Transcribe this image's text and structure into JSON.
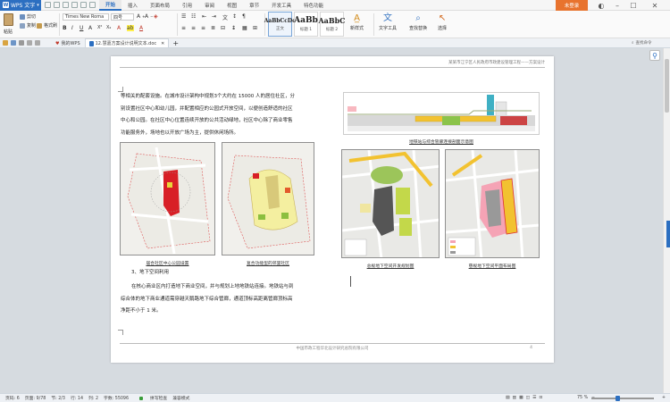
{
  "app": {
    "name": "WPS 文字",
    "login": "未登录"
  },
  "menu": [
    "开始",
    "插入",
    "页面布局",
    "引用",
    "审阅",
    "视图",
    "章节",
    "开发工具",
    "特色功能"
  ],
  "ribbon": {
    "paste": "粘贴",
    "cut": "剪切",
    "copy": "复制",
    "format_painter": "格式刷",
    "font_name": "Times New Roma",
    "font_size": "四号",
    "styles": [
      {
        "preview": "AaBbCcDd",
        "label": "正文"
      },
      {
        "preview": "AaBb",
        "label": "标题 1"
      },
      {
        "preview": "AaBbC",
        "label": "标题 2"
      }
    ],
    "new_style": "新样式",
    "text_tools": "文字工具",
    "find_replace": "查找替换",
    "select": "选择"
  },
  "tabs": {
    "home": "我的WPS",
    "doc": "12.慧嘉方案设计说明文本.doc",
    "search_cmd": "查找命令"
  },
  "document": {
    "header": "某某市江宁区人民政府市政建设管理工程——方案设计",
    "para1_lines": [
      "等相关的配套设施。在城市设计架构中规划3个大约在 15000 人的居住社区，分",
      "别设置社区中心和幼儿园，并配置相应的公园式开放空间，以便创造舒适的社区",
      "中心和公园。在社区中心位置连续开放的公共活动绿地，社区中心除了商业零售",
      "功能服务外，场地也以开放广场为主，提供休闲场所。"
    ],
    "captions": {
      "section": "地铁站与综合管廊连接剖面示意图",
      "map1": "居合社区中心公园设置",
      "map2": "复合功能型的邻里社区",
      "map3": "总规地下空间开发规划图",
      "map4": "慈规地下空间平面布局图"
    },
    "section_heading": "3、地下空间利用",
    "para2_lines": [
      "在核心商业区内打造地下商业空间，并与规划上地地铁站连接。地铁站与到",
      "综合体的地下商业通道需穿越天鹅路地下综合管廊，通道顶标高距离管廊顶标高",
      "净距不小于 1 米。"
    ],
    "footer": "中国市政工程华北设计研究总院有限公司",
    "page_number": "4"
  },
  "status": {
    "page": "页码: 6",
    "pages": "页面: 9/78",
    "section": "节: 2/3",
    "row": "行: 14",
    "col": "列: 2",
    "words": "字数: 55096",
    "spell": "拼写检查",
    "compat": "兼容模式",
    "zoom": "75 %"
  }
}
